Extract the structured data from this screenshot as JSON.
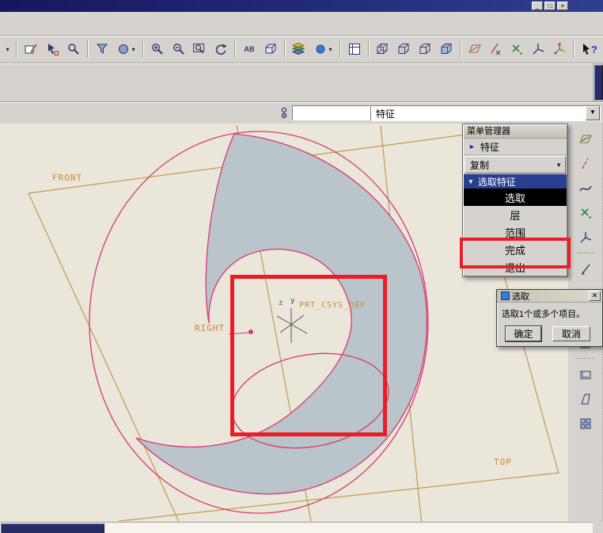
{
  "window": {
    "title": "",
    "minimize_glyph": "_",
    "restore_glyph": "□",
    "close_glyph": "×"
  },
  "toolbar": {
    "overflow_glyph": "▾",
    "dropdown_glyph": "▾",
    "views_label": "AB",
    "help_glyph": "?",
    "icon_names": [
      "toolbar-overflow",
      "sketch-edit",
      "smart-select",
      "find",
      "view-filter",
      "render-style",
      "zoom-in",
      "zoom-out",
      "zoom-fit",
      "repaint",
      "named-views",
      "saved-views",
      "layers",
      "view-manager",
      "model-tree",
      "wireframe-display",
      "hidden-line-display",
      "no-hidden-display",
      "shaded-display",
      "datum-plane-display",
      "datum-axis-display",
      "datum-point-display",
      "datum-csys-display",
      "spin-center",
      "context-help"
    ]
  },
  "feature_bar": {
    "field_value": "",
    "combo_value": "特征",
    "combo_arrow": "▼"
  },
  "canvas": {
    "front_label": "FRONT",
    "right_label": "RIGHT",
    "top_label": "TOP",
    "csys_label": "PRT_CSYS_DEF",
    "axis_z": "z",
    "axis_y": "y"
  },
  "menu_manager": {
    "title": "菜单管理器",
    "arrow_right": "►",
    "arrow_down": "▼",
    "feature": "特征",
    "copy": "复制",
    "section": "选取特征",
    "item_select": "选取",
    "item_layer": "层",
    "item_range": "范围",
    "item_done": "完成",
    "item_quit": "退出"
  },
  "select_dialog": {
    "title": "选取",
    "close_glyph": "✕",
    "message": "选取1个或多个项目。",
    "ok_label": "确定",
    "cancel_label": "取消"
  },
  "colors": {
    "annotation": "#ed1c24",
    "spiral-stroke": "#d63a6e",
    "spiral-fill": "#b9c4cb",
    "datum-line": "#c09a50",
    "datum-label": "#c9893c",
    "menu-header": "#2a3f8f",
    "selected-bg": "#000000",
    "titlebar": "#16165e",
    "scroll-thumb": "#272b66"
  }
}
